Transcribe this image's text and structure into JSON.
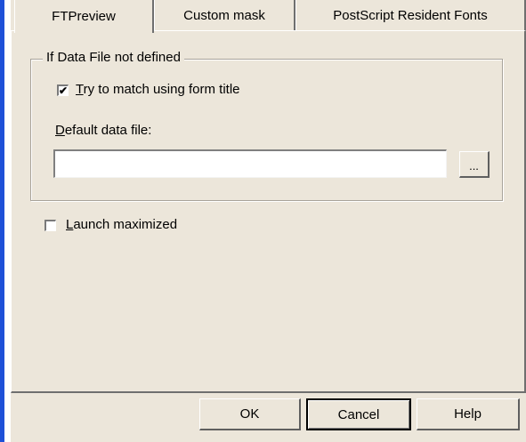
{
  "tabs": [
    {
      "label": "FTPreview",
      "active": true
    },
    {
      "label": "Custom mask",
      "active": false
    },
    {
      "label": "PostScript Resident Fonts",
      "active": false
    }
  ],
  "group": {
    "legend": "If Data File not defined",
    "match_checkbox": {
      "mnemonic": "T",
      "rest": "ry to match using form title",
      "checked": true
    },
    "default_label": {
      "mnemonic": "D",
      "rest": "efault data file:"
    },
    "default_file_value": "",
    "browse_label": "..."
  },
  "launch_checkbox": {
    "mnemonic": "L",
    "rest": "aunch maximized",
    "checked": false
  },
  "buttons": {
    "ok": "OK",
    "cancel": "Cancel",
    "help": "Help"
  },
  "colors": {
    "dialog_bg": "#ece6da",
    "accent_edge": "#1e50d8"
  }
}
